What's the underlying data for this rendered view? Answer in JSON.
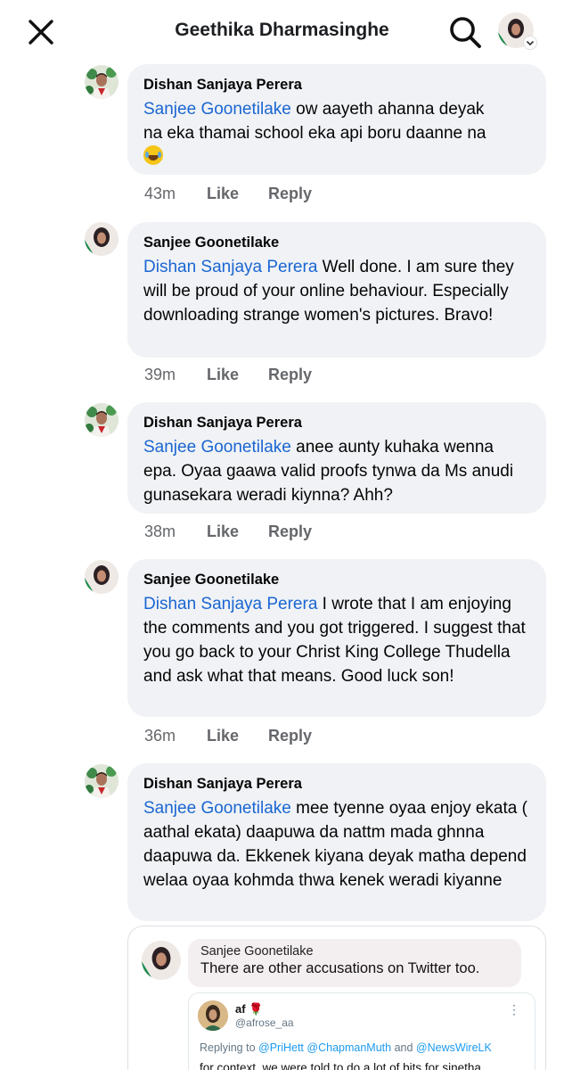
{
  "header": {
    "title": "Geethika Dharmasinghe"
  },
  "comments": [
    {
      "author": "Dishan Sanjaya Perera",
      "mention": "Sanjee Goonetilake",
      "text_lines": [
        " ow aayeth ahanna deyak",
        "na eka thamai school eka api boru daanne na"
      ],
      "emoji": "face-with-tears-of-joy",
      "time": "43m",
      "like": "Like",
      "reply": "Reply"
    },
    {
      "author": "Sanjee Goonetilake",
      "mention": "Dishan Sanjaya Perera",
      "text": " Well done. I am sure they will be proud of your online behaviour. Especially downloading strange women's pictures. Bravo!",
      "time": "39m",
      "like": "Like",
      "reply": "Reply"
    },
    {
      "author": "Dishan Sanjaya Perera",
      "mention": "Sanjee Goonetilake",
      "text": " anee aunty kuhaka wenna epa. Oyaa gaawa valid proofs tynwa da Ms anudi gunasekara weradi kiynna? Ahh?",
      "time": "38m",
      "like": "Like",
      "reply": "Reply"
    },
    {
      "author": "Sanjee Goonetilake",
      "mention": "Dishan Sanjaya Perera",
      "text": " I wrote that I am enjoying the comments and you got triggered. I suggest that you go back to your Christ King College Thudella and ask what that means. Good luck son!",
      "time": "36m",
      "like": "Like",
      "reply": "Reply"
    },
    {
      "author": "Dishan Sanjaya Perera",
      "mention": "Sanjee Goonetilake",
      "text": " mee tyenne oyaa enjoy ekata ( aathal ekata) daapuwa da nattm mada ghnna daapuwa da. Ekkenek kiyana deyak matha depend welaa oyaa kohmda thwa kenek weradi kiyanne"
    }
  ],
  "shared": {
    "author": "Sanjee Goonetilake",
    "text": "There are other accusations on Twitter too.",
    "tweet": {
      "name": "af",
      "handle": "@afrose_aa",
      "more": "⋮",
      "replying_prefix": "Replying to ",
      "mention_1": "@PriHett",
      "mention_2": "@ChapmanMuth",
      "and_word": " and ",
      "mention_3": "@NewsWireLK",
      "body_partial": "for context, we were told to do a lot of bits for sinetha"
    }
  },
  "icons": {
    "close": "close-icon",
    "search": "search-icon",
    "profile_chevron": "chevron-down-icon"
  },
  "colors": {
    "mention": "#1a66d2",
    "bubble": "#f0f2f5",
    "meta": "#65676b"
  }
}
